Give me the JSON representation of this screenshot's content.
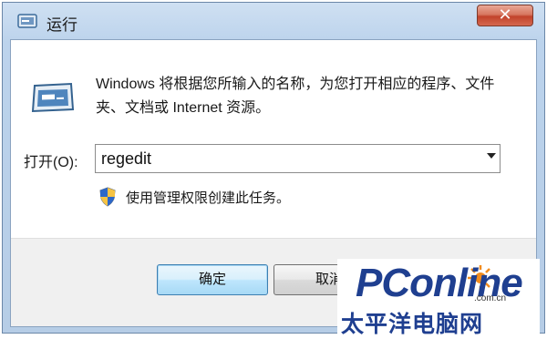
{
  "window": {
    "title": "运行",
    "close_glyph": "✕"
  },
  "dialog": {
    "description": "Windows 将根据您所输入的名称，为您打开相应的程序、文件夹、文档或 Internet 资源。",
    "open_label": "打开(O):",
    "open_value": "regedit",
    "admin_note": "使用管理权限创建此任务。"
  },
  "buttons": {
    "ok": "确定",
    "cancel": "取消"
  },
  "watermark": {
    "brand": "PConline",
    "domain": ".com.cn",
    "chinese": "太平洋电脑网"
  },
  "colors": {
    "title_bar": "#bcd3ec",
    "close_button": "#c2432b",
    "brand_blue": "#1f3f90",
    "brand_orange": "#f28c1e"
  },
  "icons": {
    "title": "run-icon",
    "main": "run-icon",
    "admin": "uac-shield-icon",
    "dropdown": "chevron-down-icon"
  }
}
